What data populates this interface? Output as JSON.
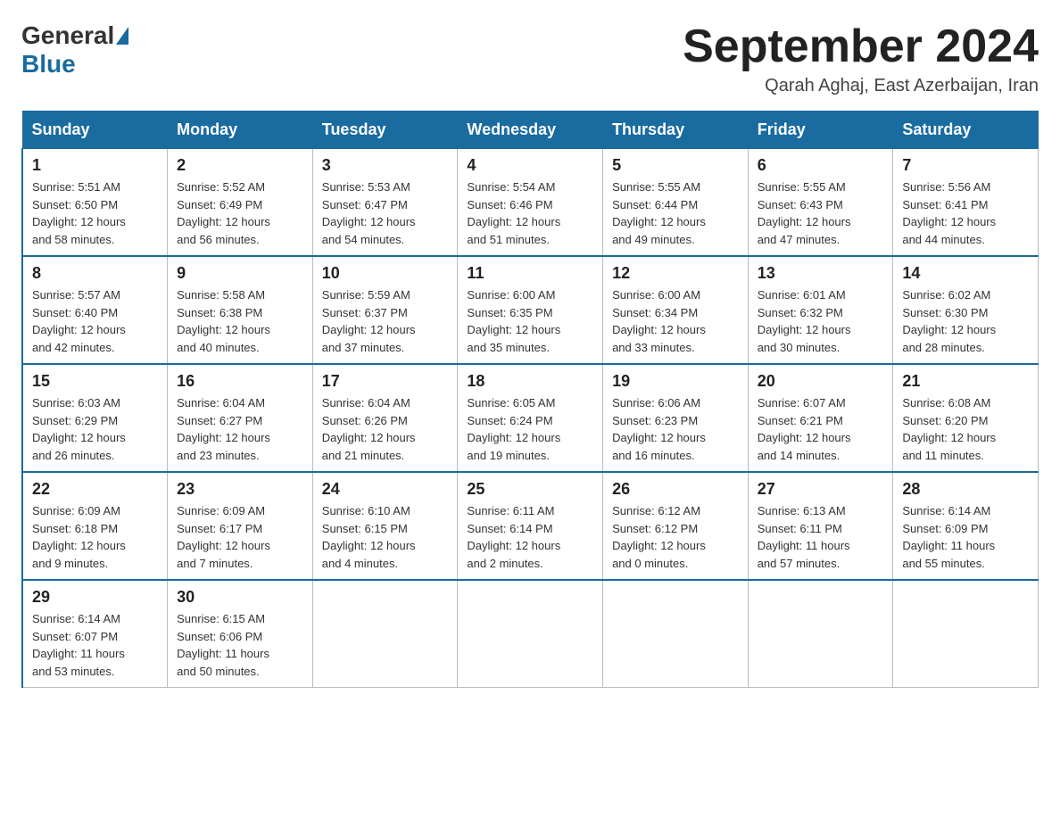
{
  "logo": {
    "general": "General",
    "blue": "Blue"
  },
  "title": "September 2024",
  "subtitle": "Qarah Aghaj, East Azerbaijan, Iran",
  "days_of_week": [
    "Sunday",
    "Monday",
    "Tuesday",
    "Wednesday",
    "Thursday",
    "Friday",
    "Saturday"
  ],
  "weeks": [
    [
      {
        "day": "1",
        "sunrise": "5:51 AM",
        "sunset": "6:50 PM",
        "daylight": "12 hours and 58 minutes."
      },
      {
        "day": "2",
        "sunrise": "5:52 AM",
        "sunset": "6:49 PM",
        "daylight": "12 hours and 56 minutes."
      },
      {
        "day": "3",
        "sunrise": "5:53 AM",
        "sunset": "6:47 PM",
        "daylight": "12 hours and 54 minutes."
      },
      {
        "day": "4",
        "sunrise": "5:54 AM",
        "sunset": "6:46 PM",
        "daylight": "12 hours and 51 minutes."
      },
      {
        "day": "5",
        "sunrise": "5:55 AM",
        "sunset": "6:44 PM",
        "daylight": "12 hours and 49 minutes."
      },
      {
        "day": "6",
        "sunrise": "5:55 AM",
        "sunset": "6:43 PM",
        "daylight": "12 hours and 47 minutes."
      },
      {
        "day": "7",
        "sunrise": "5:56 AM",
        "sunset": "6:41 PM",
        "daylight": "12 hours and 44 minutes."
      }
    ],
    [
      {
        "day": "8",
        "sunrise": "5:57 AM",
        "sunset": "6:40 PM",
        "daylight": "12 hours and 42 minutes."
      },
      {
        "day": "9",
        "sunrise": "5:58 AM",
        "sunset": "6:38 PM",
        "daylight": "12 hours and 40 minutes."
      },
      {
        "day": "10",
        "sunrise": "5:59 AM",
        "sunset": "6:37 PM",
        "daylight": "12 hours and 37 minutes."
      },
      {
        "day": "11",
        "sunrise": "6:00 AM",
        "sunset": "6:35 PM",
        "daylight": "12 hours and 35 minutes."
      },
      {
        "day": "12",
        "sunrise": "6:00 AM",
        "sunset": "6:34 PM",
        "daylight": "12 hours and 33 minutes."
      },
      {
        "day": "13",
        "sunrise": "6:01 AM",
        "sunset": "6:32 PM",
        "daylight": "12 hours and 30 minutes."
      },
      {
        "day": "14",
        "sunrise": "6:02 AM",
        "sunset": "6:30 PM",
        "daylight": "12 hours and 28 minutes."
      }
    ],
    [
      {
        "day": "15",
        "sunrise": "6:03 AM",
        "sunset": "6:29 PM",
        "daylight": "12 hours and 26 minutes."
      },
      {
        "day": "16",
        "sunrise": "6:04 AM",
        "sunset": "6:27 PM",
        "daylight": "12 hours and 23 minutes."
      },
      {
        "day": "17",
        "sunrise": "6:04 AM",
        "sunset": "6:26 PM",
        "daylight": "12 hours and 21 minutes."
      },
      {
        "day": "18",
        "sunrise": "6:05 AM",
        "sunset": "6:24 PM",
        "daylight": "12 hours and 19 minutes."
      },
      {
        "day": "19",
        "sunrise": "6:06 AM",
        "sunset": "6:23 PM",
        "daylight": "12 hours and 16 minutes."
      },
      {
        "day": "20",
        "sunrise": "6:07 AM",
        "sunset": "6:21 PM",
        "daylight": "12 hours and 14 minutes."
      },
      {
        "day": "21",
        "sunrise": "6:08 AM",
        "sunset": "6:20 PM",
        "daylight": "12 hours and 11 minutes."
      }
    ],
    [
      {
        "day": "22",
        "sunrise": "6:09 AM",
        "sunset": "6:18 PM",
        "daylight": "12 hours and 9 minutes."
      },
      {
        "day": "23",
        "sunrise": "6:09 AM",
        "sunset": "6:17 PM",
        "daylight": "12 hours and 7 minutes."
      },
      {
        "day": "24",
        "sunrise": "6:10 AM",
        "sunset": "6:15 PM",
        "daylight": "12 hours and 4 minutes."
      },
      {
        "day": "25",
        "sunrise": "6:11 AM",
        "sunset": "6:14 PM",
        "daylight": "12 hours and 2 minutes."
      },
      {
        "day": "26",
        "sunrise": "6:12 AM",
        "sunset": "6:12 PM",
        "daylight": "12 hours and 0 minutes."
      },
      {
        "day": "27",
        "sunrise": "6:13 AM",
        "sunset": "6:11 PM",
        "daylight": "11 hours and 57 minutes."
      },
      {
        "day": "28",
        "sunrise": "6:14 AM",
        "sunset": "6:09 PM",
        "daylight": "11 hours and 55 minutes."
      }
    ],
    [
      {
        "day": "29",
        "sunrise": "6:14 AM",
        "sunset": "6:07 PM",
        "daylight": "11 hours and 53 minutes."
      },
      {
        "day": "30",
        "sunrise": "6:15 AM",
        "sunset": "6:06 PM",
        "daylight": "11 hours and 50 minutes."
      },
      null,
      null,
      null,
      null,
      null
    ]
  ],
  "info_labels": {
    "sunrise": "Sunrise:",
    "sunset": "Sunset:",
    "daylight": "Daylight:"
  }
}
